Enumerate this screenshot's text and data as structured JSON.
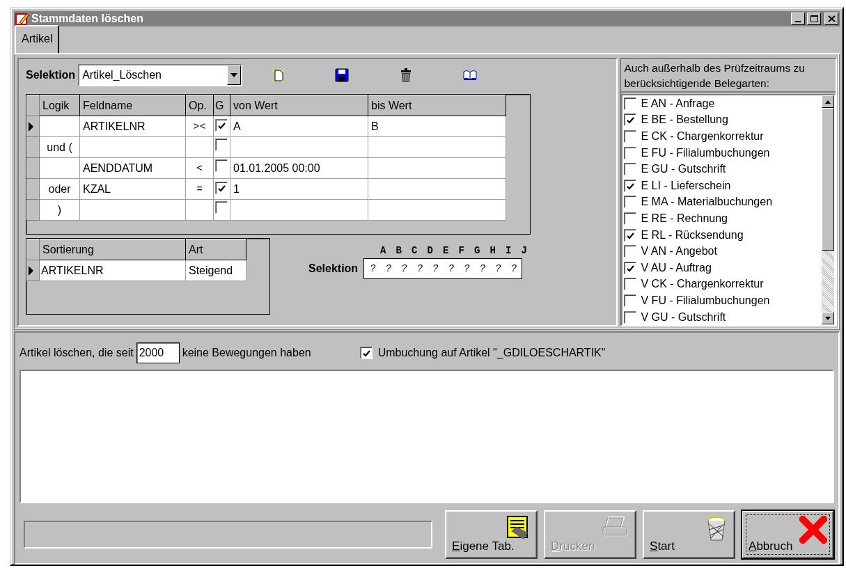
{
  "window": {
    "title": "Stammdaten löschen"
  },
  "tabs": [
    {
      "label": "Artikel",
      "selected": true
    }
  ],
  "selection": {
    "label": "Selektion",
    "value": "Artikel_Löschen"
  },
  "criteria": {
    "columns": [
      "Logik",
      "Feldname",
      "Op.",
      "G",
      "von Wert",
      "bis Wert"
    ],
    "rows": [
      {
        "selected": true,
        "logic": "",
        "field": "ARTIKELNR",
        "op": "> <",
        "checked": true,
        "from": "A",
        "to": "B"
      },
      {
        "selected": false,
        "logic": "und (",
        "field": "",
        "op": "",
        "checked": false,
        "from": "",
        "to": ""
      },
      {
        "selected": false,
        "logic": "",
        "field": "AENDDATUM",
        "op": "<",
        "checked": false,
        "from": "01.01.2005 00:00",
        "to": ""
      },
      {
        "selected": false,
        "logic": "oder",
        "field": "KZAL",
        "op": "=",
        "checked": true,
        "from": "1",
        "to": ""
      },
      {
        "selected": false,
        "logic": ")",
        "field": "",
        "op": "",
        "checked": false,
        "from": "",
        "to": ""
      }
    ]
  },
  "sorting": {
    "columns": [
      "Sortierung",
      "Art"
    ],
    "rows": [
      {
        "selected": true,
        "field": "ARTIKELNR",
        "order": "Steigend"
      }
    ]
  },
  "selection_mask": {
    "letters": [
      "A",
      "B",
      "C",
      "D",
      "E",
      "F",
      "G",
      "H",
      "I",
      "J"
    ],
    "label": "Selektion",
    "marks": [
      "?",
      "?",
      "?",
      "?",
      "?",
      "?",
      "?",
      "?",
      "?",
      "?"
    ]
  },
  "document_types": {
    "label": "Auch außerhalb des Prüfzeitraums zu berücksichtigende Belegarten:",
    "items": [
      {
        "label": "E AN - Anfrage",
        "checked": false
      },
      {
        "label": "E BE - Bestellung",
        "checked": true
      },
      {
        "label": "E CK - Chargenkorrektur",
        "checked": false
      },
      {
        "label": "E FU - Filialumbuchungen",
        "checked": false
      },
      {
        "label": "E GU - Gutschrift",
        "checked": false
      },
      {
        "label": "E LI - Lieferschein",
        "checked": true
      },
      {
        "label": "E MA - Materialbuchungen",
        "checked": false
      },
      {
        "label": "E RE - Rechnung",
        "checked": false
      },
      {
        "label": "E RL - Rücksendung",
        "checked": true
      },
      {
        "label": "V AN - Angebot",
        "checked": false
      },
      {
        "label": "V AU - Auftrag",
        "checked": true
      },
      {
        "label": "V CK - Chargenkorrektur",
        "checked": false
      },
      {
        "label": "V FU - Filialumbuchungen",
        "checked": false
      },
      {
        "label": "V GU - Gutschrift",
        "checked": false
      }
    ]
  },
  "options": {
    "before": "Artikel löschen, die seit",
    "years": "2000",
    "after": "keine Bewegungen haben",
    "rebook_label": "Umbuchung auf Artikel \"_GDILOESCHARTIK\"",
    "rebook_checked": true
  },
  "buttons": [
    {
      "label": "Eigene Tab.",
      "disabled": false,
      "default": false
    },
    {
      "label": "Drucken",
      "disabled": true,
      "default": false
    },
    {
      "label": "Start",
      "disabled": false,
      "default": false
    },
    {
      "label": "Abbruch",
      "disabled": false,
      "default": true
    }
  ]
}
